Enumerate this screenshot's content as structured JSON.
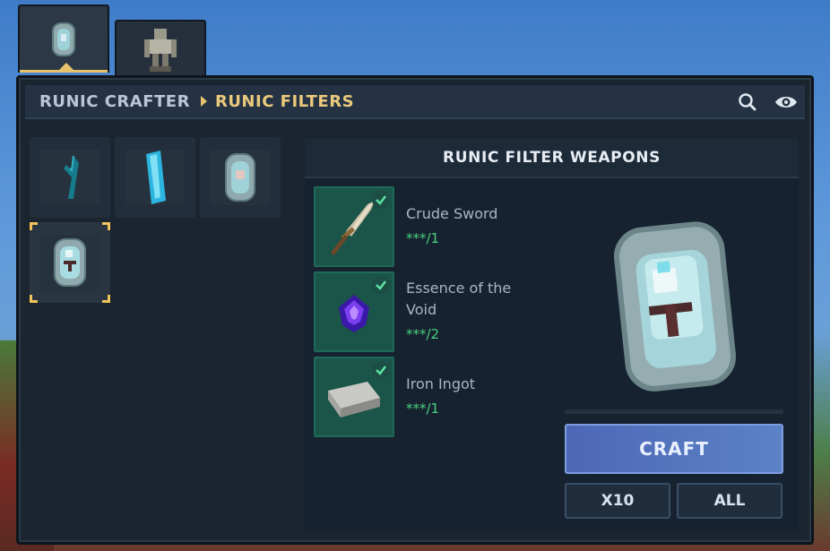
{
  "tabs": [
    {
      "icon": "runic-filter-shield-icon",
      "active": true
    },
    {
      "icon": "iron-golem-figure-icon",
      "active": false
    }
  ],
  "breadcrumb": {
    "parent": "RUNIC CRAFTER",
    "current": "RUNIC FILTERS"
  },
  "header_icons": [
    "search-icon",
    "eye-icon"
  ],
  "recipe_grid": [
    {
      "icon": "teal-twig-icon",
      "selected": false
    },
    {
      "icon": "cyan-crystal-bar-icon",
      "selected": false
    },
    {
      "icon": "runic-filter-icon",
      "selected": false
    },
    {
      "icon": "runic-filter-weapons-icon",
      "selected": true
    }
  ],
  "panel": {
    "title": "RUNIC FILTER WEAPONS",
    "ingredients": [
      {
        "name": "Crude Sword",
        "count": "***/1",
        "icon": "crude-sword-icon"
      },
      {
        "name": "Essence of the Void",
        "count": "***/2",
        "icon": "void-essence-icon"
      },
      {
        "name": "Iron Ingot",
        "count": "***/1",
        "icon": "iron-ingot-icon"
      }
    ],
    "preview_icon": "runic-filter-weapons-icon",
    "craft_label": "CRAFT",
    "x10_label": "X10",
    "all_label": "ALL"
  },
  "colors": {
    "accent_gold": "#e8c26a",
    "count_green": "#49d17d",
    "craft_blue": "#5b82c6"
  }
}
